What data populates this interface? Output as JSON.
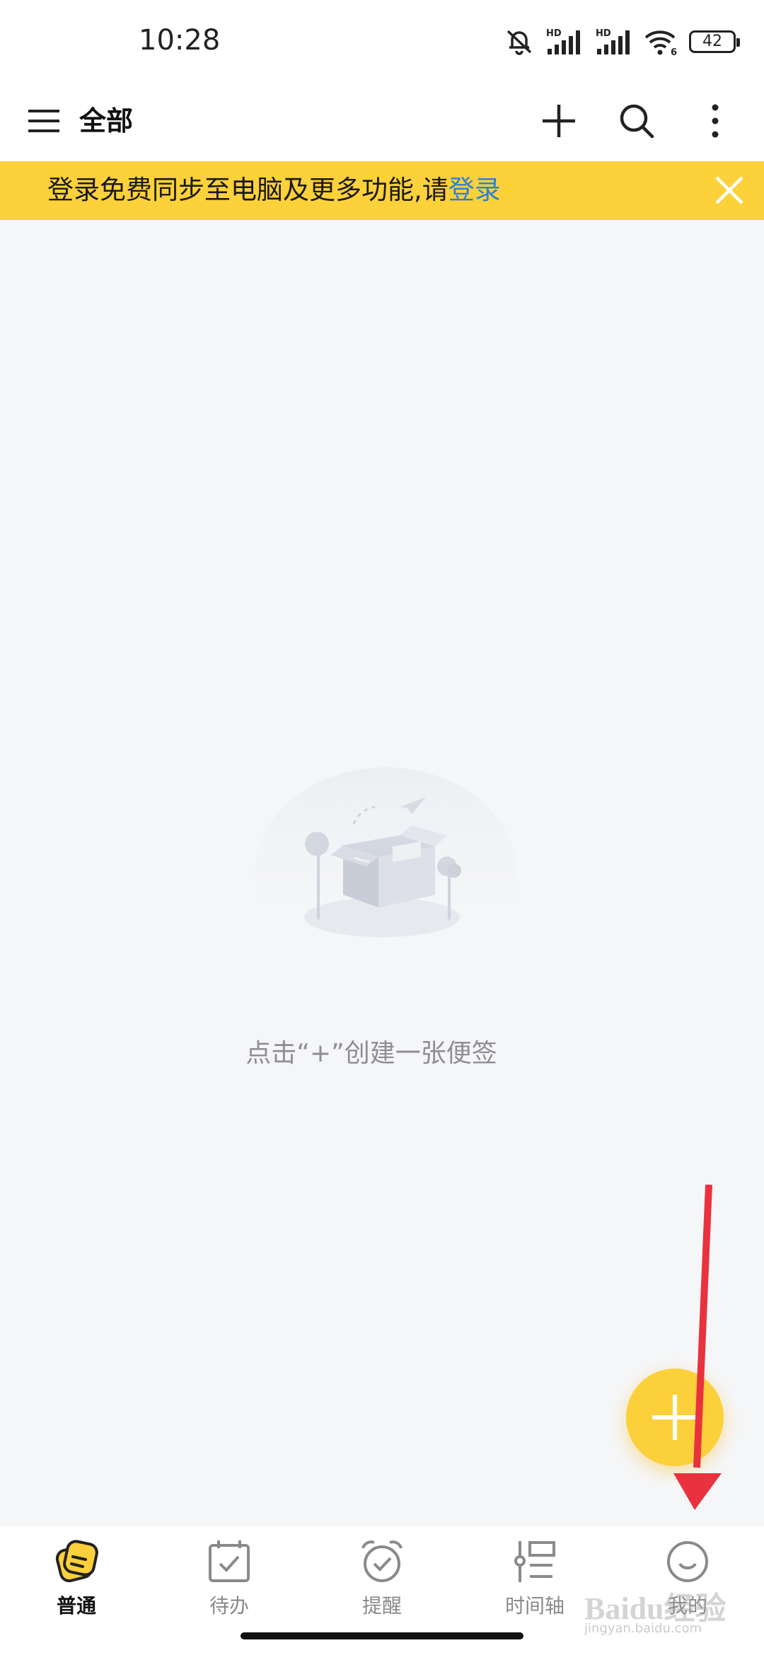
{
  "status_bar": {
    "time": "10:28",
    "battery": "42",
    "icons": [
      "mute-icon",
      "signal-hd-icon",
      "signal-hd-icon",
      "wifi-6-icon",
      "battery-icon"
    ]
  },
  "app_bar": {
    "title": "全部",
    "icons": [
      "menu-icon",
      "plus-icon",
      "search-icon",
      "more-vertical-icon"
    ]
  },
  "banner": {
    "text": "登录免费同步至电脑及更多功能,请",
    "link": "登录",
    "background": "#fdd13a",
    "link_color": "#2d80d8"
  },
  "empty_state": {
    "message": "点击“+”创建一张便签",
    "illustration": "empty-box-illustration"
  },
  "fab": {
    "icon": "plus-icon",
    "color": "#fcd03a"
  },
  "bottom_nav": {
    "items": [
      {
        "label": "普通",
        "icon": "notes-icon",
        "active": true
      },
      {
        "label": "待办",
        "icon": "calendar-check-icon",
        "active": false
      },
      {
        "label": "提醒",
        "icon": "alarm-clock-icon",
        "active": false
      },
      {
        "label": "时间轴",
        "icon": "timeline-icon",
        "active": false
      },
      {
        "label": "我的",
        "icon": "smiley-icon",
        "active": false
      }
    ]
  },
  "watermark": {
    "text": "Baidu经验",
    "sub": "jingyan.baidu.com"
  },
  "annotation": {
    "type": "red-arrow",
    "color": "#e8333f"
  }
}
